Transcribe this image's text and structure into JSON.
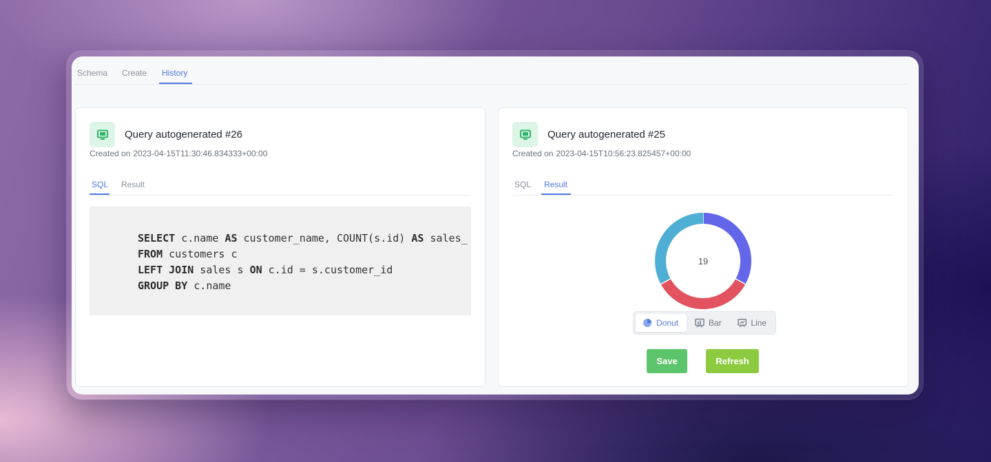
{
  "top_tabs": [
    {
      "label": "Schema",
      "active": false
    },
    {
      "label": "Create",
      "active": false
    },
    {
      "label": "History",
      "active": true
    }
  ],
  "cards": [
    {
      "title": "Query autogenerated #26",
      "created_prefix": "Created on",
      "created_at": "2023-04-15T11:30:46.834333+00:00",
      "tabs": [
        {
          "label": "SQL",
          "active": true
        },
        {
          "label": "Result",
          "active": false
        }
      ],
      "sql_tokens": [
        [
          [
            "kw",
            "SELECT"
          ],
          [
            "t",
            " c.name "
          ],
          [
            "kw",
            "AS"
          ],
          [
            "t",
            " customer_name, COUNT(s.id) "
          ],
          [
            "kw",
            "AS"
          ],
          [
            "t",
            " sales_"
          ]
        ],
        [
          [
            "kw",
            "FROM"
          ],
          [
            "t",
            " customers c"
          ]
        ],
        [
          [
            "kw",
            "LEFT JOIN"
          ],
          [
            "t",
            " sales s "
          ],
          [
            "kw",
            "ON"
          ],
          [
            "t",
            " c.id = s.customer_id"
          ]
        ],
        [
          [
            "kw",
            "GROUP BY"
          ],
          [
            "t",
            " c.name"
          ]
        ]
      ]
    },
    {
      "title": "Query autogenerated #25",
      "created_prefix": "Created on",
      "created_at": "2023-04-15T10:56:23.825457+00:00",
      "tabs": [
        {
          "label": "SQL",
          "active": false
        },
        {
          "label": "Result",
          "active": true
        }
      ],
      "donut": {
        "center_label": "19",
        "colors": [
          "#6366e8",
          "#e2525f",
          "#4eaed3"
        ],
        "shares": [
          0.33,
          0.34,
          0.33
        ]
      },
      "chart_types": [
        {
          "label": "Donut",
          "icon": "pie-chart-icon",
          "active": true
        },
        {
          "label": "Bar",
          "icon": "bar-chart-icon",
          "active": false
        },
        {
          "label": "Line",
          "icon": "line-chart-icon",
          "active": false
        }
      ],
      "save_label": "Save",
      "refresh_label": "Refresh"
    }
  ],
  "colors": {
    "accent": "#4f78e0",
    "icon_green": "#2fb36b",
    "save_green": "#5cc46a",
    "refresh_green": "#8ccb3f"
  }
}
